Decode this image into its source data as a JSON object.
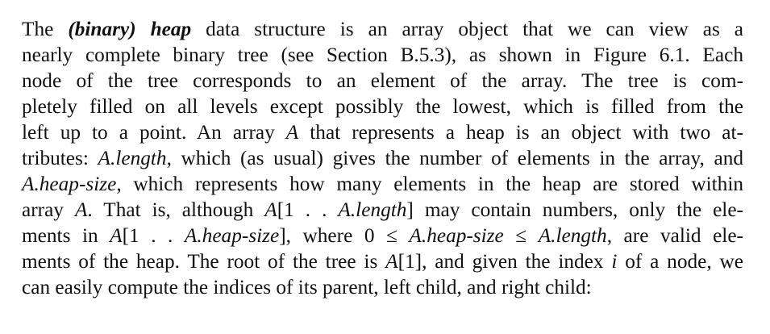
{
  "paragraph": {
    "lines": [
      [
        {
          "t": "The "
        },
        {
          "t": "(binary) heap",
          "s": "bi"
        },
        {
          "t": " data structure is an array object that we can view as a"
        }
      ],
      [
        {
          "t": "nearly complete binary tree (see Section B.5.3), as shown in Figure 6.1.  Each"
        }
      ],
      [
        {
          "t": "node of the tree corresponds to an element of the array.  The tree is com-"
        }
      ],
      [
        {
          "t": "pletely filled on all levels except possibly the lowest, which is filled from the"
        }
      ],
      [
        {
          "t": "left up to a point.  An array "
        },
        {
          "t": "A",
          "s": "it"
        },
        {
          "t": " that represents a heap is an object with two at-"
        }
      ],
      [
        {
          "t": "tributes: "
        },
        {
          "t": "A.length",
          "s": "it"
        },
        {
          "t": ", which (as usual) gives the number of elements in the array, and"
        }
      ],
      [
        {
          "t": "A.heap-size",
          "s": "it"
        },
        {
          "t": ", which represents how many elements in the heap are stored within"
        }
      ],
      [
        {
          "t": "array "
        },
        {
          "t": "A",
          "s": "it"
        },
        {
          "t": ".  That is, although "
        },
        {
          "t": "A",
          "s": "it"
        },
        {
          "t": "[1 . . "
        },
        {
          "t": "A.length",
          "s": "it"
        },
        {
          "t": "] may contain numbers, only the ele-"
        }
      ],
      [
        {
          "t": "ments in "
        },
        {
          "t": "A",
          "s": "it"
        },
        {
          "t": "[1 . . "
        },
        {
          "t": "A.heap-size",
          "s": "it"
        },
        {
          "t": "], where 0 ≤ "
        },
        {
          "t": "A.heap-size",
          "s": "it"
        },
        {
          "t": " ≤ "
        },
        {
          "t": "A.length",
          "s": "it"
        },
        {
          "t": ", are valid ele-"
        }
      ],
      [
        {
          "t": "ments of the heap. The root of the tree is "
        },
        {
          "t": "A",
          "s": "it"
        },
        {
          "t": "[1], and given the index "
        },
        {
          "t": "i",
          "s": "it"
        },
        {
          "t": " of a node, we"
        }
      ],
      [
        {
          "t": "can easily compute the indices of its parent, left child, and right child:"
        }
      ]
    ]
  }
}
